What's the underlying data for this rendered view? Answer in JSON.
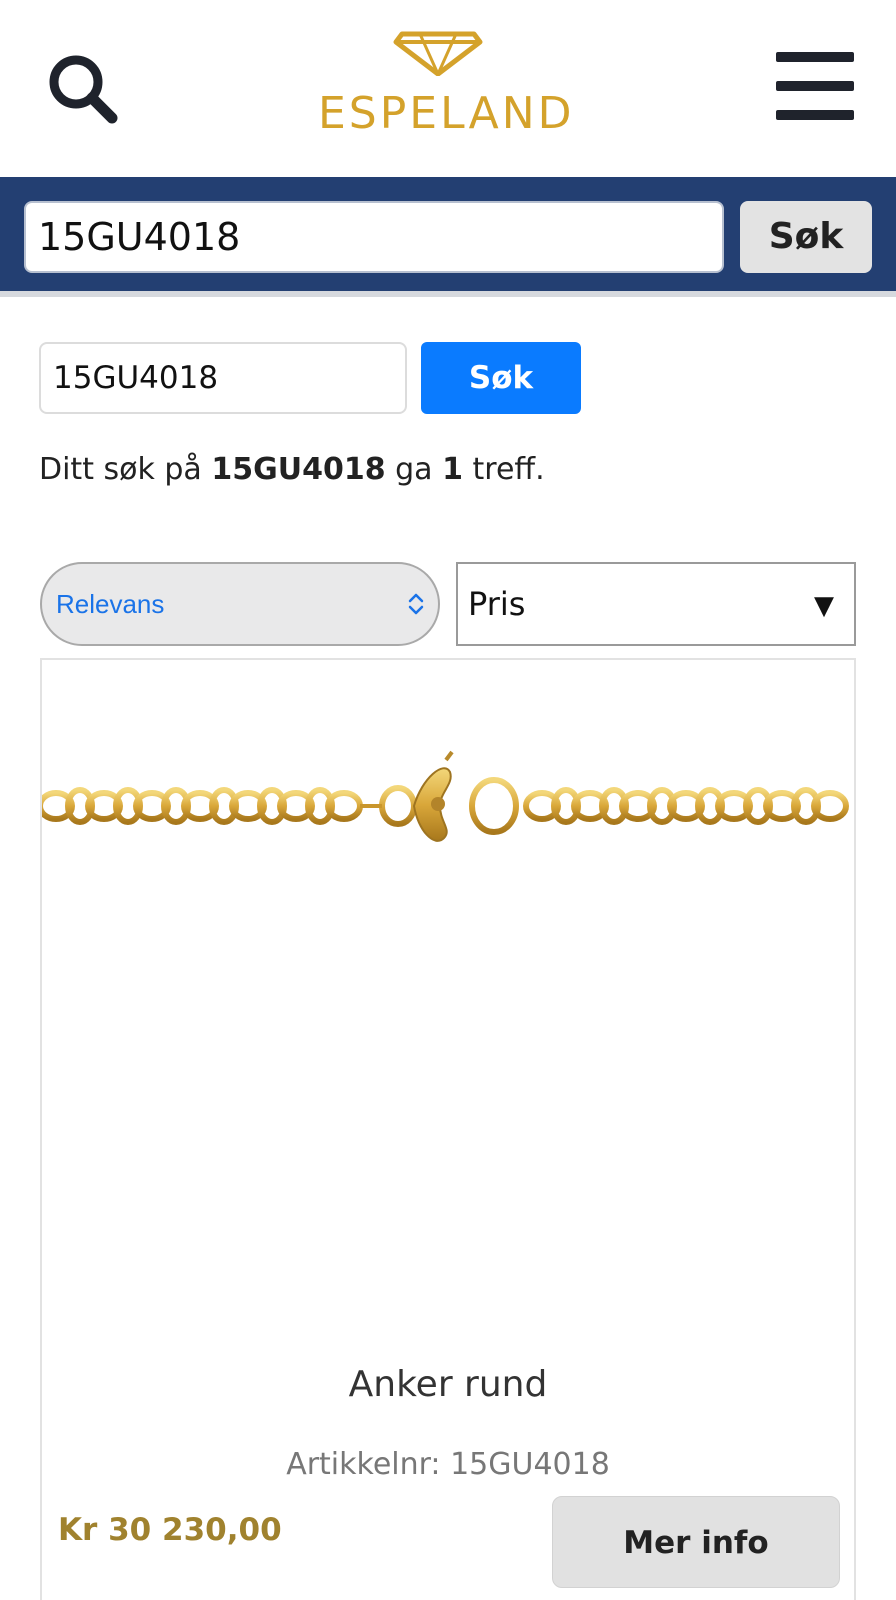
{
  "header": {
    "logo_text": "ESPELAND",
    "search_icon": "search-icon",
    "menu_icon": "hamburger-menu-icon"
  },
  "top_search": {
    "value": "15GU4018",
    "button_label": "Søk"
  },
  "inline_search": {
    "value": "15GU4018",
    "button_label": "Søk"
  },
  "results": {
    "prefix": "Ditt søk på ",
    "query": "15GU4018",
    "middle": " ga ",
    "count": "1",
    "suffix": " treff."
  },
  "sorting": {
    "sort_selected": "Relevans",
    "price_selected": "Pris",
    "price_arrow": "▼"
  },
  "product": {
    "name": "Anker rund",
    "sku": "Artikkelnr: 15GU4018",
    "price": "Kr 30 230,00",
    "button_label": "Mer info"
  },
  "colors": {
    "header_bar": "#233f72",
    "brand_gold": "#d4a22b",
    "primary_button": "#0a7bff",
    "price": "#a0822e"
  }
}
